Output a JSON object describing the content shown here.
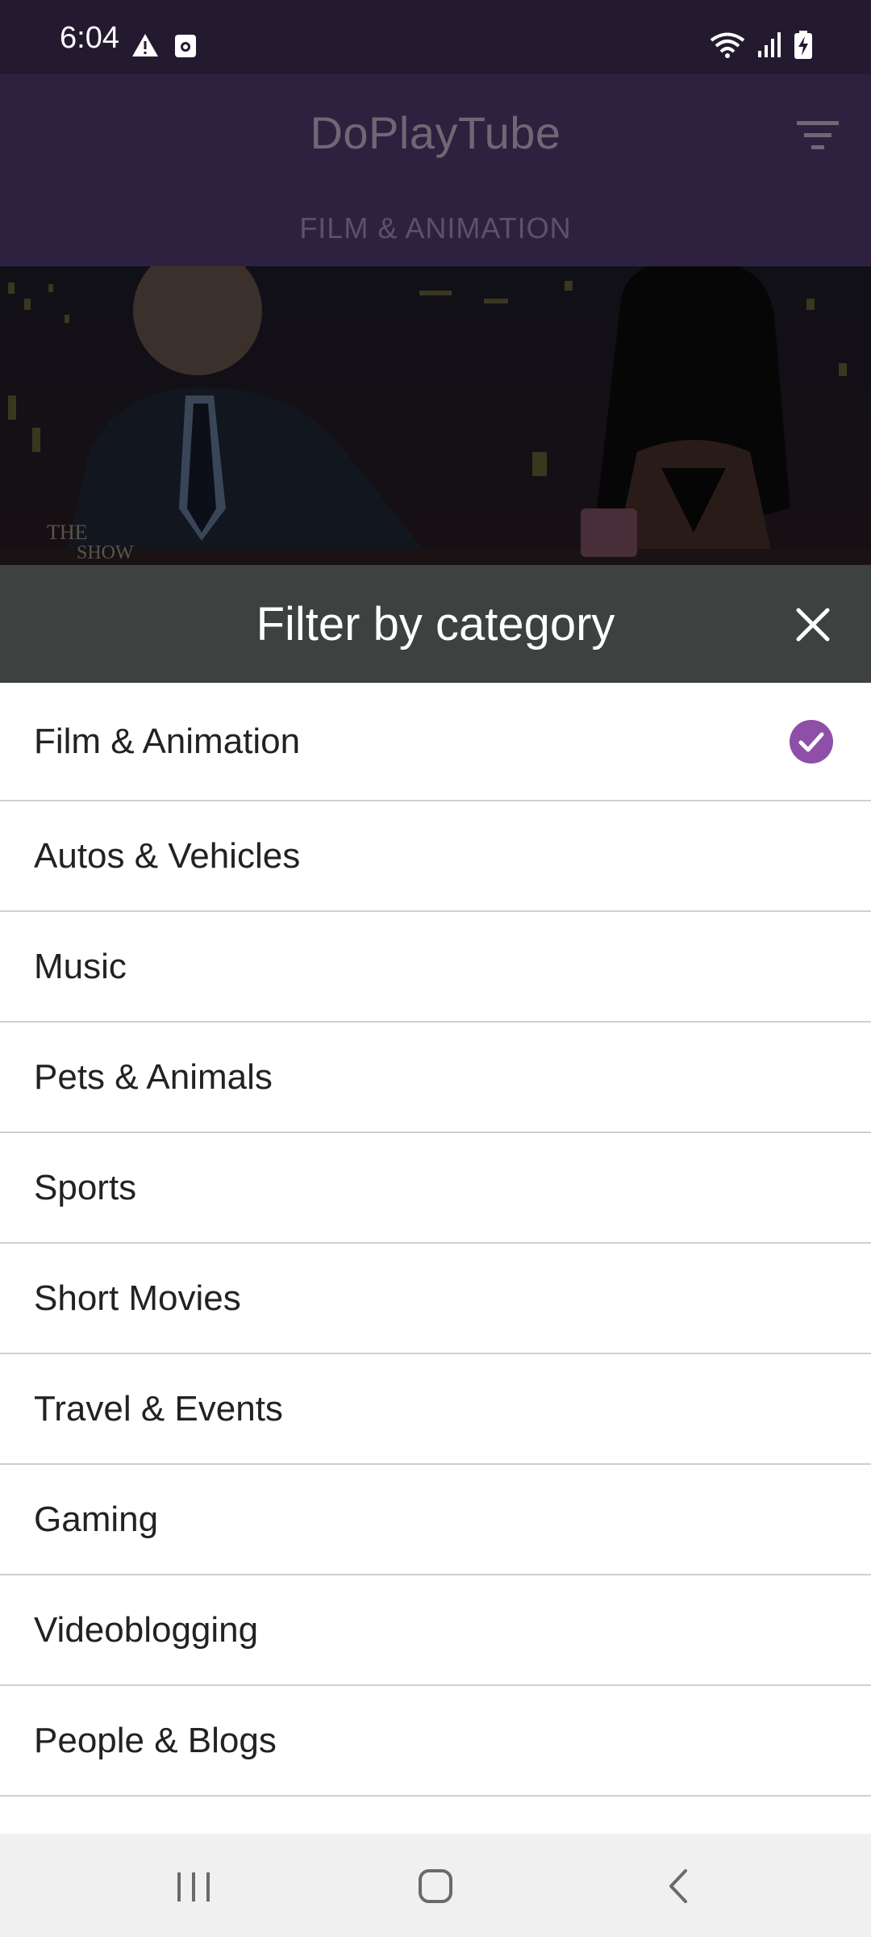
{
  "status_bar": {
    "time": "6:04",
    "icons": [
      "warning-icon",
      "app-notification-icon",
      "wifi-icon",
      "signal-icon",
      "battery-charging-icon"
    ]
  },
  "app": {
    "title": "DoPlayTube",
    "subtitle": "FILM & ANIMATION",
    "header_color": "#2e2140"
  },
  "sheet": {
    "title": "Filter by category",
    "header_color": "#3d4140",
    "accent_color": "#8e4fa8"
  },
  "categories": [
    {
      "label": "Film & Animation",
      "selected": true
    },
    {
      "label": "Autos & Vehicles",
      "selected": false
    },
    {
      "label": "Music",
      "selected": false
    },
    {
      "label": "Pets & Animals",
      "selected": false
    },
    {
      "label": "Sports",
      "selected": false
    },
    {
      "label": "Short Movies",
      "selected": false
    },
    {
      "label": "Travel & Events",
      "selected": false
    },
    {
      "label": "Gaming",
      "selected": false
    },
    {
      "label": "Videoblogging",
      "selected": false
    },
    {
      "label": "People & Blogs",
      "selected": false
    }
  ],
  "nav_bar": {
    "buttons": [
      "recent-apps",
      "home",
      "back"
    ]
  }
}
